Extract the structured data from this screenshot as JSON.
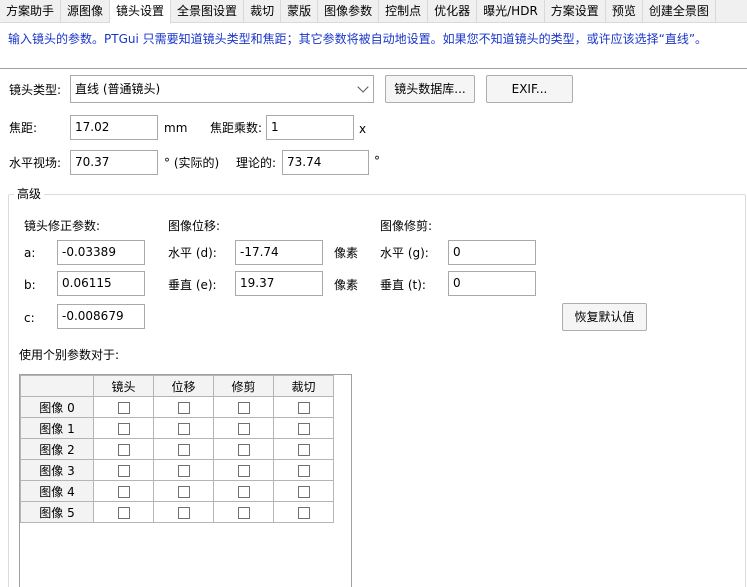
{
  "tabs": [
    {
      "label": "方案助手",
      "active": false
    },
    {
      "label": "源图像",
      "active": false
    },
    {
      "label": "镜头设置",
      "active": true
    },
    {
      "label": "全景图设置",
      "active": false
    },
    {
      "label": "裁切",
      "active": false
    },
    {
      "label": "蒙版",
      "active": false
    },
    {
      "label": "图像参数",
      "active": false
    },
    {
      "label": "控制点",
      "active": false
    },
    {
      "label": "优化器",
      "active": false
    },
    {
      "label": "曝光/HDR",
      "active": false
    },
    {
      "label": "方案设置",
      "active": false
    },
    {
      "label": "预览",
      "active": false
    },
    {
      "label": "创建全景图",
      "active": false
    }
  ],
  "info_text": "输入镜头的参数。PTGui 只需要知道镜头类型和焦距；其它参数将被自动地设置。如果您不知道镜头的类型，或许应该选择“直线”。",
  "lens": {
    "type_label": "镜头类型:",
    "type_value": "直线 (普通镜头)",
    "db_button": "镜头数据库...",
    "exif_button": "EXIF...",
    "focal_label": "焦距:",
    "focal_value": "17.02",
    "focal_unit": "mm",
    "multiplier_label": "焦距乘数:",
    "multiplier_value": "1",
    "multiplier_unit": "x",
    "hfov_label": "水平视场:",
    "hfov_value": "70.37",
    "hfov_unit": "° (实际的)",
    "theory_label": "理论的:",
    "theory_value": "73.74",
    "theory_unit": "°"
  },
  "advanced": {
    "title": "高级",
    "correction_label": "镜头修正参数:",
    "a_label": "a:",
    "a_value": "-0.03389",
    "b_label": "b:",
    "b_value": "0.06115",
    "c_label": "c:",
    "c_value": "-0.008679",
    "shift_label": "图像位移:",
    "shift_h_label": "水平 (d):",
    "shift_h_value": "-17.74",
    "shift_h_unit": "像素",
    "shift_v_label": "垂直 (e):",
    "shift_v_value": "19.37",
    "shift_v_unit": "像素",
    "shear_label": "图像修剪:",
    "shear_h_label": "水平 (g):",
    "shear_h_value": "0",
    "shear_v_label": "垂直 (t):",
    "shear_v_value": "0",
    "reset_button": "恢复默认值",
    "individual_label": "使用个别参数对于:"
  },
  "table": {
    "columns": [
      "镜头",
      "位移",
      "修剪",
      "裁切"
    ],
    "rows": [
      "图像 0",
      "图像 1",
      "图像 2",
      "图像 3",
      "图像 4",
      "图像 5"
    ]
  }
}
